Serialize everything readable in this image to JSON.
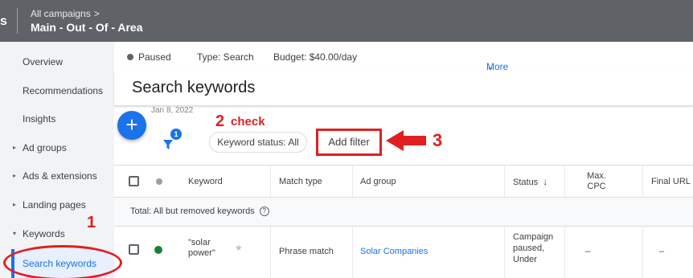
{
  "topbar": {
    "logo_fragment": "s",
    "breadcrumb": "All campaigns",
    "breadcrumb_chevron": ">",
    "campaign": "Main - Out - Of - Area"
  },
  "sidebar": {
    "items": [
      {
        "label": "Overview",
        "expandable": false
      },
      {
        "label": "Recommendations",
        "expandable": false
      },
      {
        "label": "Insights",
        "expandable": false
      },
      {
        "label": "Ad groups",
        "expandable": true
      },
      {
        "label": "Ads & extensions",
        "expandable": true
      },
      {
        "label": "Landing pages",
        "expandable": true
      },
      {
        "label": "Keywords",
        "expanded": true
      },
      {
        "label": "Search keywords",
        "active": true
      }
    ],
    "expand_glyph": "▸",
    "expanded_glyph": "▾"
  },
  "status_bar": {
    "status": "Paused",
    "type": "Type: Search",
    "budget": "Budget: $40.00/day",
    "more_details": "More details",
    "chevron": "⌄"
  },
  "page": {
    "title": "Search keywords",
    "date_fragment": "Jan 8, 2022"
  },
  "fab": {
    "label": "+"
  },
  "filters": {
    "badge_count": "1",
    "chip": "Keyword status: All",
    "add_filter": "Add filter"
  },
  "annotations": {
    "step1": "1",
    "step2": "2",
    "step2_text": "check",
    "step3": "3",
    "color": "#e02020"
  },
  "table": {
    "headers": {
      "keyword": "Keyword",
      "match_type": "Match type",
      "ad_group": "Ad group",
      "status": "Status",
      "status_sort": "↓",
      "max_cpc_line1": "Max.",
      "max_cpc_line2": "CPC",
      "final_url": "Final URL"
    },
    "total_label": "Total: All but removed keywords",
    "help_glyph": "?",
    "rows": [
      {
        "keyword_line1": "\"solar",
        "keyword_line2": "power\"",
        "star": "★",
        "match_type": "Phrase match",
        "ad_group": "Solar Companies",
        "status_line1": "Campaign",
        "status_line2": "paused,",
        "status_line3": "Under",
        "max_cpc": "–",
        "final_url": "–",
        "status_color": "#188038"
      }
    ]
  },
  "colors": {
    "accent": "#1a73e8",
    "topbar": "#5f6368",
    "annotation": "#e02020"
  }
}
